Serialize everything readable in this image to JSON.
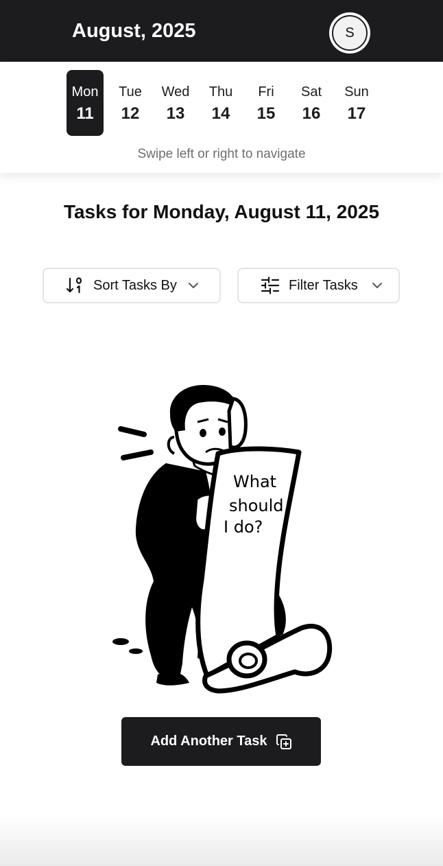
{
  "header": {
    "month_title": "August, 2025",
    "avatar_initial": "S"
  },
  "week": {
    "days": [
      {
        "name": "Mon",
        "num": "11",
        "selected": true
      },
      {
        "name": "Tue",
        "num": "12",
        "selected": false
      },
      {
        "name": "Wed",
        "num": "13",
        "selected": false
      },
      {
        "name": "Thu",
        "num": "14",
        "selected": false
      },
      {
        "name": "Fri",
        "num": "15",
        "selected": false
      },
      {
        "name": "Sat",
        "num": "16",
        "selected": false
      },
      {
        "name": "Sun",
        "num": "17",
        "selected": false
      }
    ],
    "hint": "Swipe left or right to navigate"
  },
  "main": {
    "heading": "Tasks for Monday, August 11, 2025",
    "sort_label": "Sort Tasks By",
    "filter_label": "Filter Tasks",
    "illustration_text": [
      "What",
      "should",
      "I do?"
    ],
    "add_task_label": "Add Another Task"
  },
  "icons": {
    "sort": "sort-arrow-icon",
    "filter": "sliders-icon",
    "chevron": "chevron-down-icon",
    "add": "copy-plus-icon"
  },
  "colors": {
    "dark": "#1c1c1e",
    "muted_text": "#6e6e73",
    "border": "#e4e4e7",
    "background": "#ffffff"
  }
}
